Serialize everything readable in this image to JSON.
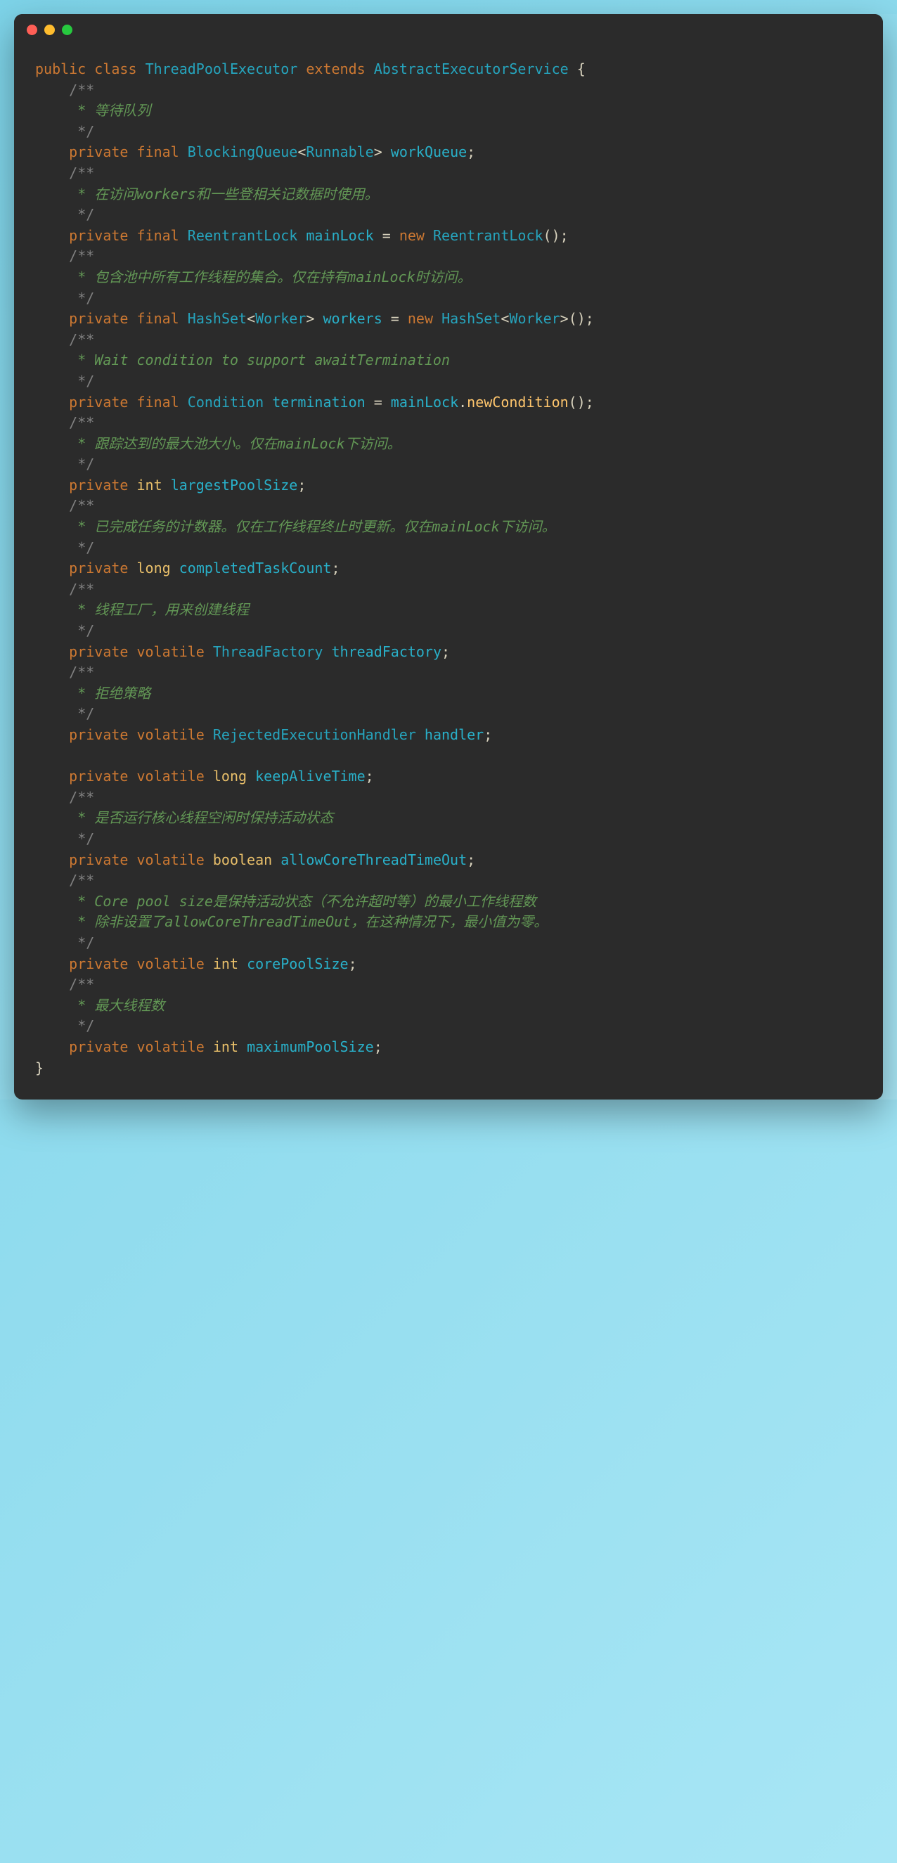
{
  "code": {
    "l1": {
      "kw1": "public",
      "kw2": "class",
      "t1": "ThreadPoolExecutor",
      "kw3": "extends",
      "t2": "AbstractExecutorService",
      "brace": "{"
    },
    "c1": {
      "open": "/**",
      "body": " * 等待队列",
      "close": " */"
    },
    "f1": {
      "kw1": "private",
      "kw2": "final",
      "t1": "BlockingQueue",
      "lt": "<",
      "t2": "Runnable",
      "gt": ">",
      "id": "workQueue",
      "end": ";"
    },
    "c2": {
      "open": "/**",
      "body": " * 在访问workers和一些登相关记数据时使用。",
      "close": " */"
    },
    "f2": {
      "kw1": "private",
      "kw2": "final",
      "t1": "ReentrantLock",
      "id": "mainLock",
      "eq": " = ",
      "kw3": "new",
      "t2": "ReentrantLock",
      "call": "();"
    },
    "c3": {
      "open": "/**",
      "body": " * 包含池中所有工作线程的集合。仅在持有mainLock时访问。",
      "close": " */"
    },
    "f3": {
      "kw1": "private",
      "kw2": "final",
      "t1": "HashSet",
      "lt": "<",
      "t2": "Worker",
      "gt": ">",
      "id": "workers",
      "eq": " = ",
      "kw3": "new",
      "t3": "HashSet",
      "lt2": "<",
      "t4": "Worker",
      "gt2": ">",
      "call": "();"
    },
    "c4": {
      "open": "/**",
      "body": " * Wait condition to support awaitTermination",
      "close": " */"
    },
    "f4": {
      "kw1": "private",
      "kw2": "final",
      "t1": "Condition",
      "id": "termination",
      "eq": " = ",
      "obj": "mainLock",
      "dot": ".",
      "m": "newCondition",
      "call": "();"
    },
    "c5": {
      "open": "/**",
      "body": " * 跟踪达到的最大池大小。仅在mainLock下访问。",
      "close": " */"
    },
    "f5": {
      "kw1": "private",
      "pt": "int",
      "id": "largestPoolSize",
      "end": ";"
    },
    "c6": {
      "open": "/**",
      "body": " * 已完成任务的计数器。仅在工作线程终止时更新。仅在mainLock下访问。",
      "close": " */"
    },
    "f6": {
      "kw1": "private",
      "pt": "long",
      "id": "completedTaskCount",
      "end": ";"
    },
    "c7": {
      "open": "/**",
      "body": " * 线程工厂，用来创建线程",
      "close": " */"
    },
    "f7": {
      "kw1": "private",
      "kw2": "volatile",
      "t1": "ThreadFactory",
      "id": "threadFactory",
      "end": ";"
    },
    "c8": {
      "open": "/**",
      "body": " * 拒绝策略",
      "close": " */"
    },
    "f8": {
      "kw1": "private",
      "kw2": "volatile",
      "t1": "RejectedExecutionHandler",
      "id": "handler",
      "end": ";"
    },
    "f9": {
      "kw1": "private",
      "kw2": "volatile",
      "pt": "long",
      "id": "keepAliveTime",
      "end": ";"
    },
    "c9": {
      "open": "/**",
      "body": " * 是否运行核心线程空闲时保持活动状态",
      "close": " */"
    },
    "f10": {
      "kw1": "private",
      "kw2": "volatile",
      "pt": "boolean",
      "id": "allowCoreThreadTimeOut",
      "end": ";"
    },
    "c10": {
      "open": "/**",
      "body1": " * Core pool size是保持活动状态（不允许超时等）的最小工作线程数",
      "body2": " * 除非设置了allowCoreThreadTimeOut，在这种情况下，最小值为零。",
      "close": " */"
    },
    "f11": {
      "kw1": "private",
      "kw2": "volatile",
      "pt": "int",
      "id": "corePoolSize",
      "end": ";"
    },
    "c11": {
      "open": "/**",
      "body": " * 最大线程数",
      "close": " */"
    },
    "f12": {
      "kw1": "private",
      "kw2": "volatile",
      "pt": "int",
      "id": "maximumPoolSize",
      "end": ";"
    },
    "close": "}"
  }
}
